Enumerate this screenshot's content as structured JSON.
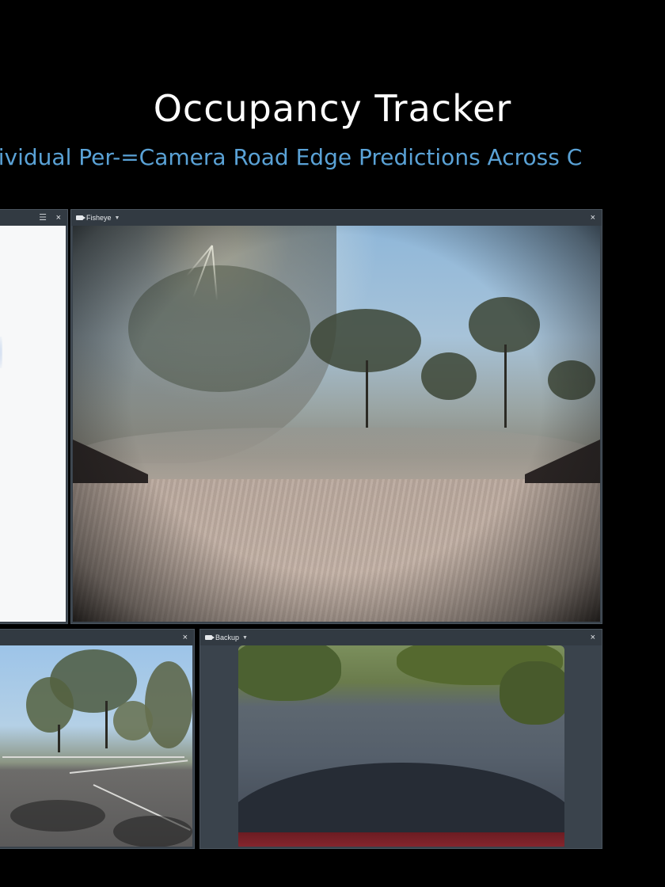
{
  "slide": {
    "title": "Occupancy Tracker",
    "subtitle": "dividual Per-=Camera Road Edge Predictions Across C",
    "background_color": "#000000",
    "title_color": "#ffffff",
    "subtitle_color": "#5aa2d6"
  },
  "panels": {
    "topview": {
      "title": "",
      "close_label": "×",
      "layers_label": "☰",
      "icon": "layers-icon"
    },
    "fisheye": {
      "title": "Fisheye",
      "caret": "▼",
      "close_label": "×",
      "icon": "camera-icon"
    },
    "side": {
      "title": "",
      "close_label": "×"
    },
    "backup": {
      "title": "Backup",
      "caret": "▼",
      "close_label": "×",
      "icon": "camera-icon"
    }
  },
  "colors": {
    "panel_bg": "#3a434c",
    "panel_header": "#323a42",
    "panel_text": "#e6e9ec"
  }
}
